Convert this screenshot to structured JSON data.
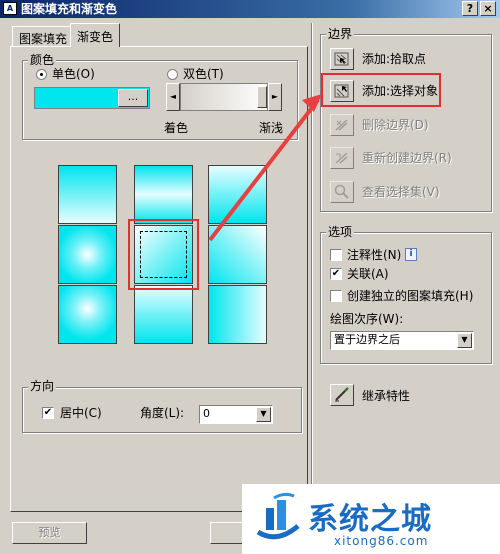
{
  "window": {
    "title": "图案填充和渐变色",
    "help_label": "?",
    "close_label": "×"
  },
  "tabs": [
    {
      "label": "图案填充",
      "active": false
    },
    {
      "label": "渐变色",
      "active": true
    }
  ],
  "color_group": {
    "legend": "颜色",
    "single_label": "单色(O)",
    "double_label": "双色(T)",
    "selected": "single",
    "swatch_color": "#00e5ee",
    "browse_label": "...",
    "slider_left_label": "◄",
    "slider_right_label": "►",
    "shade_label": "着色",
    "tint_label": "渐浅"
  },
  "gradient_tiles": {
    "selected_index": 4
  },
  "direction_group": {
    "legend": "方向",
    "centered_label": "居中(C)",
    "centered_checked": true,
    "angle_label": "角度(L):",
    "angle_value": "0"
  },
  "boundary_group": {
    "legend": "边界",
    "items": [
      {
        "label": "添加:拾取点",
        "icon": "pick-points-icon",
        "enabled": true
      },
      {
        "label": "添加:选择对象",
        "icon": "select-objects-icon",
        "enabled": true
      },
      {
        "label": "删除边界(D)",
        "icon": "remove-boundary-icon",
        "enabled": false
      },
      {
        "label": "重新创建边界(R)",
        "icon": "recreate-boundary-icon",
        "enabled": false
      },
      {
        "label": "查看选择集(V)",
        "icon": "view-selection-icon",
        "enabled": false
      }
    ]
  },
  "options_group": {
    "legend": "选项",
    "annotative_label": "注释性(N)",
    "annotative_checked": false,
    "info_label": "i",
    "associative_label": "关联(A)",
    "associative_checked": true,
    "separate_label": "创建独立的图案填充(H)",
    "separate_checked": false,
    "draw_order_label": "绘图次序(W):",
    "draw_order_value": "置于边界之后"
  },
  "inherit_label": "继承特性",
  "check_mark": "✔",
  "dropdown_arrow": "▼",
  "bottom": {
    "preview_label": "预览"
  },
  "watermark": {
    "title": "系统之城",
    "subtitle": "xitong86.com"
  },
  "colors": {
    "cyan": "#00e5ee",
    "highlight_red": "#e03131",
    "arrow_red": "#e84040"
  }
}
